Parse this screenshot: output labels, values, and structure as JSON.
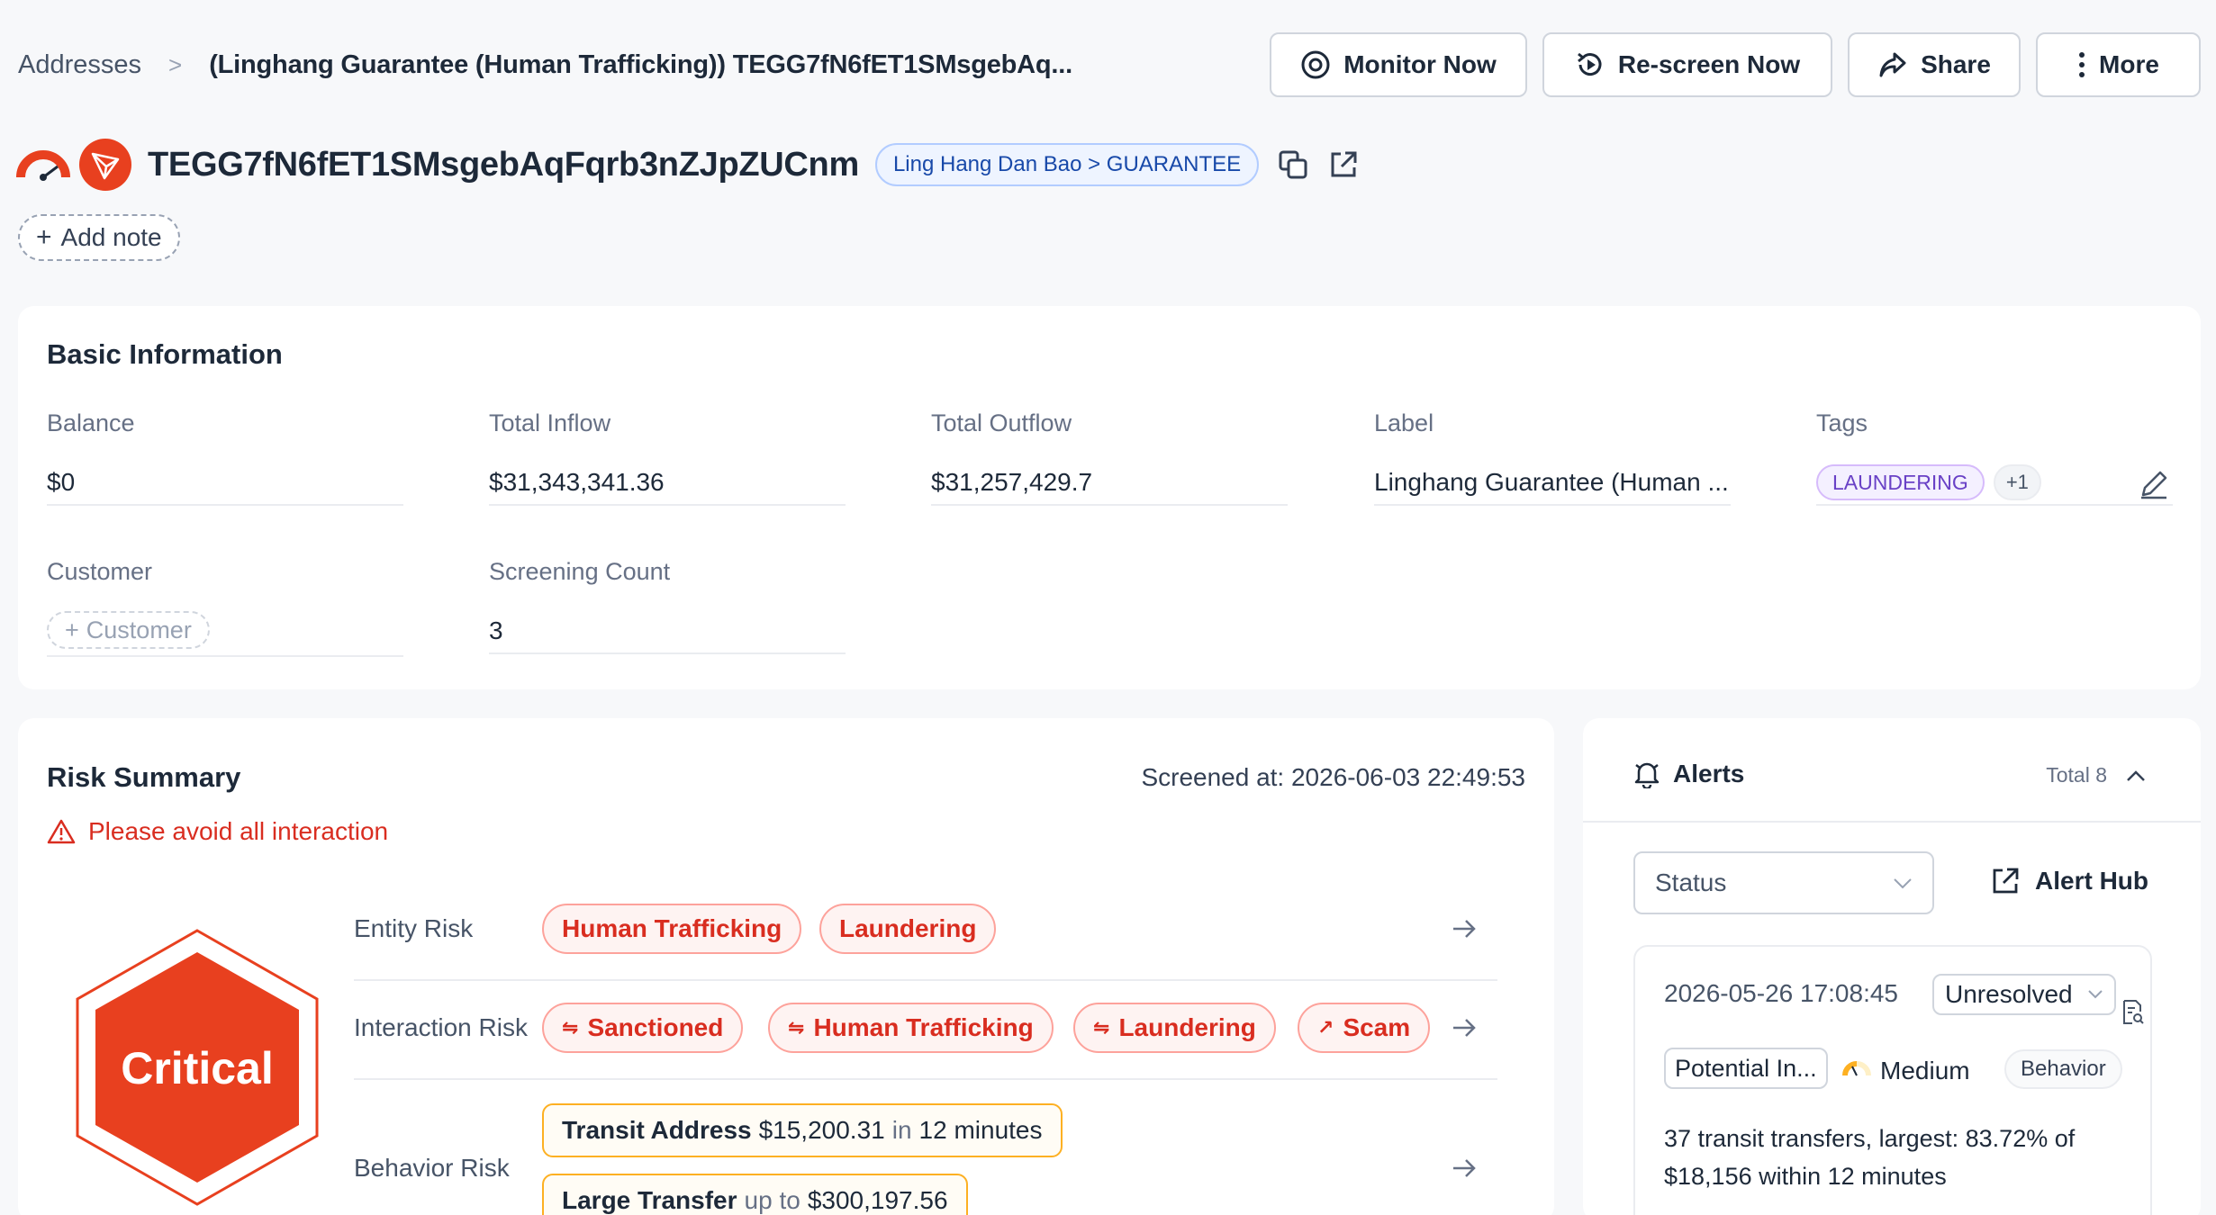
{
  "breadcrumb": {
    "root": "Addresses",
    "separator": ">",
    "current": "(Linghang Guarantee (Human Trafficking)) TEGG7fN6fET1SMsgebAq..."
  },
  "header_actions": {
    "monitor": "Monitor Now",
    "rescreen": "Re-screen Now",
    "share": "Share",
    "more": "More"
  },
  "address": {
    "value": "TEGG7fN6fET1SMsgebAqFqrb3nZJpZUCnm",
    "entity_label": "Ling Hang Dan Bao > GUARANTEE",
    "add_note": "Add note"
  },
  "basic_info": {
    "title": "Basic Information",
    "fields": {
      "balance": {
        "label": "Balance",
        "value": "$0"
      },
      "inflow": {
        "label": "Total Inflow",
        "value": "$31,343,341.36"
      },
      "outflow": {
        "label": "Total Outflow",
        "value": "$31,257,429.7"
      },
      "label": {
        "label": "Label",
        "value": "Linghang Guarantee (Human ..."
      },
      "tags": {
        "label": "Tags",
        "primary": "LAUNDERING",
        "extra": "+1"
      },
      "customer": {
        "label": "Customer",
        "placeholder": "Customer"
      },
      "screening_count": {
        "label": "Screening Count",
        "value": "3"
      }
    }
  },
  "risk_summary": {
    "title": "Risk Summary",
    "screened_at": "Screened at: 2026-06-03 22:49:53",
    "warning": "Please avoid all interaction",
    "level": "Critical",
    "entity_risk": {
      "label": "Entity Risk",
      "chips": [
        "Human Trafficking",
        "Laundering"
      ]
    },
    "interaction_risk": {
      "label": "Interaction Risk",
      "chips": [
        "Sanctioned",
        "Human Trafficking",
        "Laundering",
        "Scam"
      ]
    },
    "behavior_risk": {
      "label": "Behavior Risk",
      "items": [
        {
          "name": "Transit Address",
          "amount": "$15,200.31",
          "connector": "in",
          "detail": "12 minutes"
        },
        {
          "name": "Large Transfer",
          "amount": "",
          "connector": "up to",
          "detail": "$300,197.56"
        }
      ]
    }
  },
  "alerts": {
    "title": "Alerts",
    "total": "Total 8",
    "status_placeholder": "Status",
    "alert_hub": "Alert Hub",
    "card": {
      "timestamp": "2026-05-26 17:08:45",
      "status": "Unresolved",
      "type": "Potential In...",
      "severity": "Medium",
      "category": "Behavior",
      "description": "37 transit transfers, largest: 83.72% of $18,156 within 12 minutes"
    }
  },
  "colors": {
    "critical": "#e8401f",
    "risk_red": "#d92d20",
    "tag_purple": "#6941c6",
    "chip_blue": "#1849a9",
    "behavior_border": "#fdb022"
  }
}
